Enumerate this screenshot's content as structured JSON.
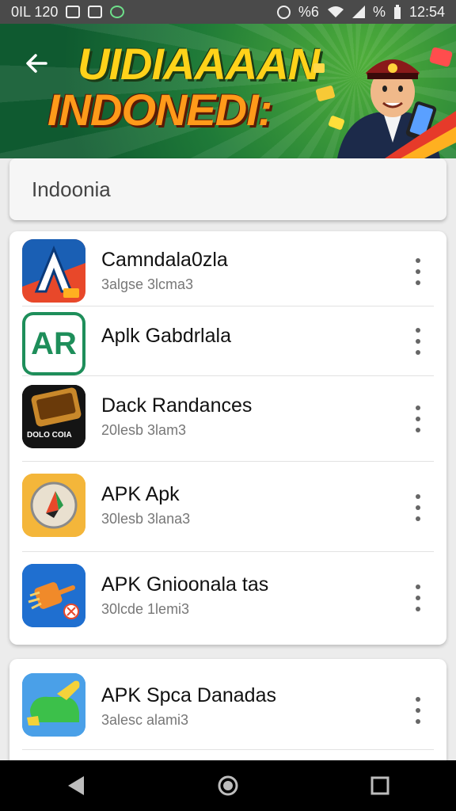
{
  "status_bar": {
    "left_text": "0IL 120",
    "right_text": "%6",
    "right_text2": "%",
    "time": "12:54",
    "icons": [
      "image-icon",
      "photo-icon",
      "whatsapp-icon",
      "location-icon",
      "wifi-icon",
      "signal-icon",
      "battery-icon"
    ]
  },
  "banner": {
    "title_line1": "UIDIAAAAN",
    "title_line2": "INDONEDI:",
    "back_icon": "arrow-left-icon"
  },
  "search": {
    "value": "Indoonia"
  },
  "apps": [
    {
      "name": "Camndala0zla",
      "subtitle": "3algse 3lcma3",
      "icon": "app-icon-blue-a"
    },
    {
      "name": "Aplk Gabdrlala",
      "subtitle": "",
      "icon": "app-icon-ar"
    },
    {
      "name": "Dack Randances",
      "subtitle": "20lesb 3lam3",
      "icon": "app-icon-phone-dark"
    },
    {
      "name": "APK Apk",
      "subtitle": "30lesb 3lana3",
      "icon": "app-icon-compass"
    },
    {
      "name": "APK Gnioonala tas",
      "subtitle": "30lcde 1lemi3",
      "icon": "app-icon-plug"
    }
  ],
  "apps2": [
    {
      "name": "APK Spca Danadas",
      "subtitle": "3alesc alami3",
      "icon": "app-icon-green-shoe"
    }
  ],
  "icon_ar_label": "AR",
  "icon_phone_label": "DOLO COIA",
  "nav": [
    "back-triangle-icon",
    "home-circle-icon",
    "recents-square-icon"
  ],
  "colors": {
    "banner_green": "#1f7a38",
    "title_yellow": "#ffd21a",
    "title_orange": "#ff9a1a",
    "ar_green": "#1e8e5a"
  }
}
